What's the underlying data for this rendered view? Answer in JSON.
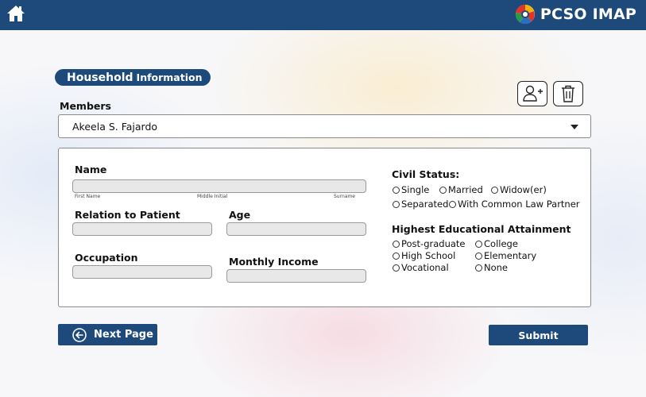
{
  "header": {
    "home_icon": "home-icon",
    "brand_logo_icon": "pcso-logo-icon",
    "brand_name": "PCSO IMAP",
    "bar_color": "#1d4a7a"
  },
  "section": {
    "title_main": "Household",
    "title_sub": "Information"
  },
  "actions": {
    "add_member_icon": "add-user-icon",
    "delete_member_icon": "trash-icon"
  },
  "members": {
    "label": "Members",
    "selected": "Akeela S. Fajardo"
  },
  "form": {
    "name": {
      "label": "Name",
      "value": "",
      "sub_first": "First Name",
      "sub_middle": "Middle Initial",
      "sub_last": "Surname"
    },
    "relation": {
      "label": "Relation to Patient",
      "value": ""
    },
    "age": {
      "label": "Age",
      "value": ""
    },
    "occupation": {
      "label": "Occupation",
      "value": ""
    },
    "income": {
      "label": "Monthly Income",
      "value": ""
    },
    "civil_status": {
      "title": "Civil Status:",
      "options": [
        "Single",
        "Married",
        "Widow(er)",
        "Separated",
        "With Common Law Partner"
      ]
    },
    "education": {
      "title": "Highest Educational Attainment",
      "options": [
        "Post-graduate",
        "College",
        "High School",
        "Elementary",
        "Vocational",
        "None"
      ]
    }
  },
  "footer": {
    "next_label": "Next Page",
    "next_icon": "arrow-left-circle-icon",
    "submit_label": "Submit"
  }
}
